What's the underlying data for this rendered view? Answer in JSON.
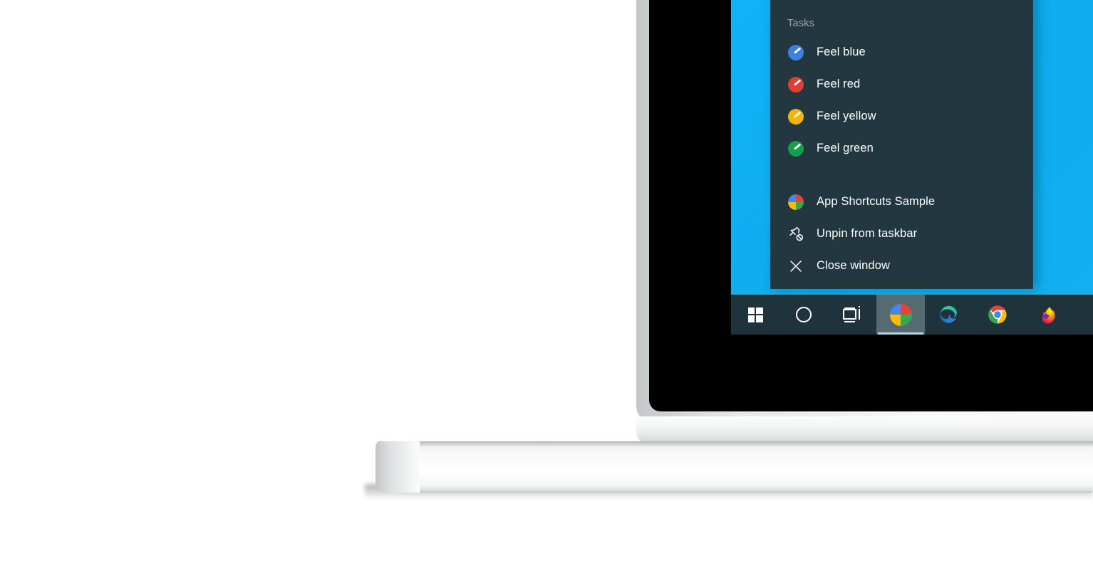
{
  "scene": {
    "device": "laptop",
    "colors": {
      "desktop_background": "#12b0f3",
      "jumplist_background": "#233741",
      "taskbar_background": "#1f333d",
      "active_highlight": "#566a72",
      "active_underline": "#9fd8f5",
      "title_text": "#9aa7ad",
      "item_text": "#ffffff"
    }
  },
  "jumplist": {
    "title": "Tasks",
    "tasks": [
      {
        "label": "Feel blue",
        "icon": "blue-brush-icon",
        "color": "#3b82e0"
      },
      {
        "label": "Feel red",
        "icon": "red-brush-icon",
        "color": "#e03e30"
      },
      {
        "label": "Feel yellow",
        "icon": "yellow-brush-icon",
        "color": "#f5b405"
      },
      {
        "label": "Feel green",
        "icon": "green-brush-icon",
        "color": "#13a04b"
      }
    ],
    "actions": [
      {
        "label": "App Shortcuts Sample",
        "icon": "app-quad-icon"
      },
      {
        "label": "Unpin from taskbar",
        "icon": "unpin-icon"
      },
      {
        "label": "Close window",
        "icon": "close-window-icon"
      }
    ]
  },
  "taskbar": {
    "buttons": [
      {
        "name": "start",
        "icon": "windows-logo-icon",
        "active": false
      },
      {
        "name": "cortana",
        "icon": "cortana-circle-icon",
        "active": false
      },
      {
        "name": "task-view",
        "icon": "task-view-icon",
        "active": false
      },
      {
        "name": "app-shortcuts-sample",
        "icon": "app-quad-icon",
        "active": true
      },
      {
        "name": "microsoft-edge",
        "icon": "edge-icon",
        "active": false
      },
      {
        "name": "google-chrome",
        "icon": "chrome-icon",
        "active": false
      },
      {
        "name": "mozilla-firefox",
        "icon": "firefox-icon",
        "active": false
      }
    ]
  },
  "app_icon_quadrants": {
    "top_left": "#4285f4",
    "top_right": "#ea4335",
    "bottom_left": "#fbbc04",
    "bottom_right": "#34a853"
  }
}
